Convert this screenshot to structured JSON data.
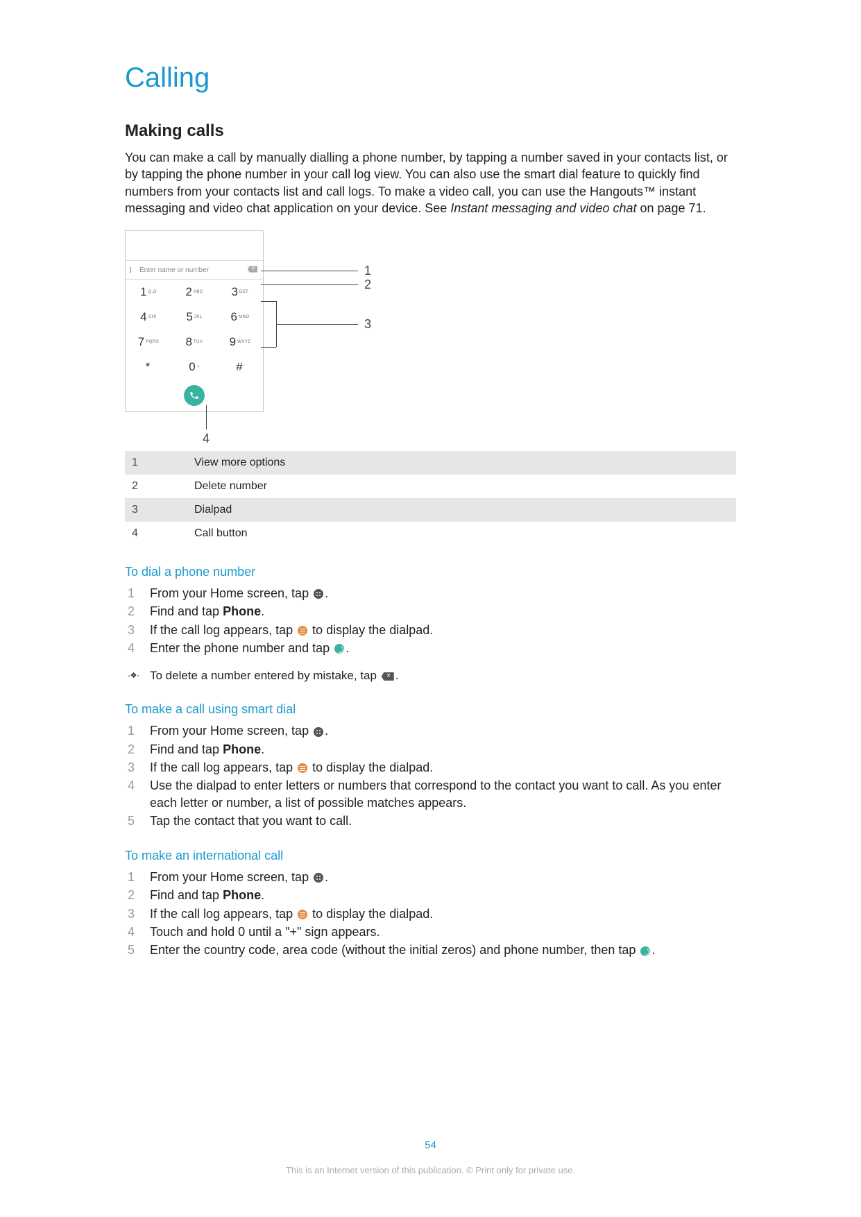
{
  "title": "Calling",
  "section": "Making calls",
  "intro_a": "You can make a call by manually dialling a phone number, by tapping a number saved in your contacts list, or by tapping the phone number in your call log view. You can also use the smart dial feature to quickly find numbers from your contacts list and call logs. To make a video call, you can use the Hangouts™ instant messaging and video chat application on your device. See ",
  "intro_em": "Instant messaging and video chat",
  "intro_b": " on page 71.",
  "dialer": {
    "placeholder": "Enter name or number",
    "keys": [
      {
        "big": "1",
        "sm": "Q,O"
      },
      {
        "big": "2",
        "sm": "ABC"
      },
      {
        "big": "3",
        "sm": "DEF"
      },
      {
        "big": "4",
        "sm": "GHI"
      },
      {
        "big": "5",
        "sm": "JKL"
      },
      {
        "big": "6",
        "sm": "MNO"
      },
      {
        "big": "7",
        "sm": "PQRS"
      },
      {
        "big": "8",
        "sm": "TUV"
      },
      {
        "big": "9",
        "sm": "WXYZ"
      },
      {
        "big": "*",
        "sm": ""
      },
      {
        "big": "0",
        "sm": "+"
      },
      {
        "big": "#",
        "sm": ""
      }
    ],
    "callouts": {
      "c1": "1",
      "c2": "2",
      "c3": "3",
      "c4": "4"
    }
  },
  "legend": [
    {
      "n": "1",
      "d": "View more options"
    },
    {
      "n": "2",
      "d": "Delete number"
    },
    {
      "n": "3",
      "d": "Dialpad"
    },
    {
      "n": "4",
      "d": "Call button"
    }
  ],
  "procs": [
    {
      "title": "To dial a phone number",
      "steps": [
        {
          "n": "1",
          "parts": [
            "From your Home screen, tap ",
            {
              "icon": "apps"
            },
            "."
          ]
        },
        {
          "n": "2",
          "parts": [
            "Find and tap ",
            {
              "bold": "Phone"
            },
            "."
          ]
        },
        {
          "n": "3",
          "parts": [
            "If the call log appears, tap ",
            {
              "icon": "dialpad"
            },
            " to display the dialpad."
          ]
        },
        {
          "n": "4",
          "parts": [
            "Enter the phone number and tap ",
            {
              "icon": "call"
            },
            "."
          ]
        }
      ],
      "tip": {
        "parts": [
          "To delete a number entered by mistake, tap ",
          {
            "icon": "delx"
          },
          "."
        ]
      }
    },
    {
      "title": "To make a call using smart dial",
      "steps": [
        {
          "n": "1",
          "parts": [
            "From your Home screen, tap ",
            {
              "icon": "apps"
            },
            "."
          ]
        },
        {
          "n": "2",
          "parts": [
            "Find and tap ",
            {
              "bold": "Phone"
            },
            "."
          ]
        },
        {
          "n": "3",
          "parts": [
            "If the call log appears, tap ",
            {
              "icon": "dialpad"
            },
            " to display the dialpad."
          ]
        },
        {
          "n": "4",
          "parts": [
            "Use the dialpad to enter letters or numbers that correspond to the contact you want to call. As you enter each letter or number, a list of possible matches appears."
          ]
        },
        {
          "n": "5",
          "parts": [
            "Tap the contact that you want to call."
          ]
        }
      ]
    },
    {
      "title": "To make an international call",
      "steps": [
        {
          "n": "1",
          "parts": [
            "From your Home screen, tap ",
            {
              "icon": "apps"
            },
            "."
          ]
        },
        {
          "n": "2",
          "parts": [
            "Find and tap ",
            {
              "bold": "Phone"
            },
            "."
          ]
        },
        {
          "n": "3",
          "parts": [
            "If the call log appears, tap ",
            {
              "icon": "dialpad"
            },
            " to display the dialpad."
          ]
        },
        {
          "n": "4",
          "parts": [
            "Touch and hold 0 until a \"+\" sign appears."
          ]
        },
        {
          "n": "5",
          "parts": [
            "Enter the country code, area code (without the initial zeros) and phone number, then tap ",
            {
              "icon": "call"
            },
            "."
          ]
        }
      ]
    }
  ],
  "pagenum": "54",
  "footnote": "This is an Internet version of this publication. © Print only for private use."
}
